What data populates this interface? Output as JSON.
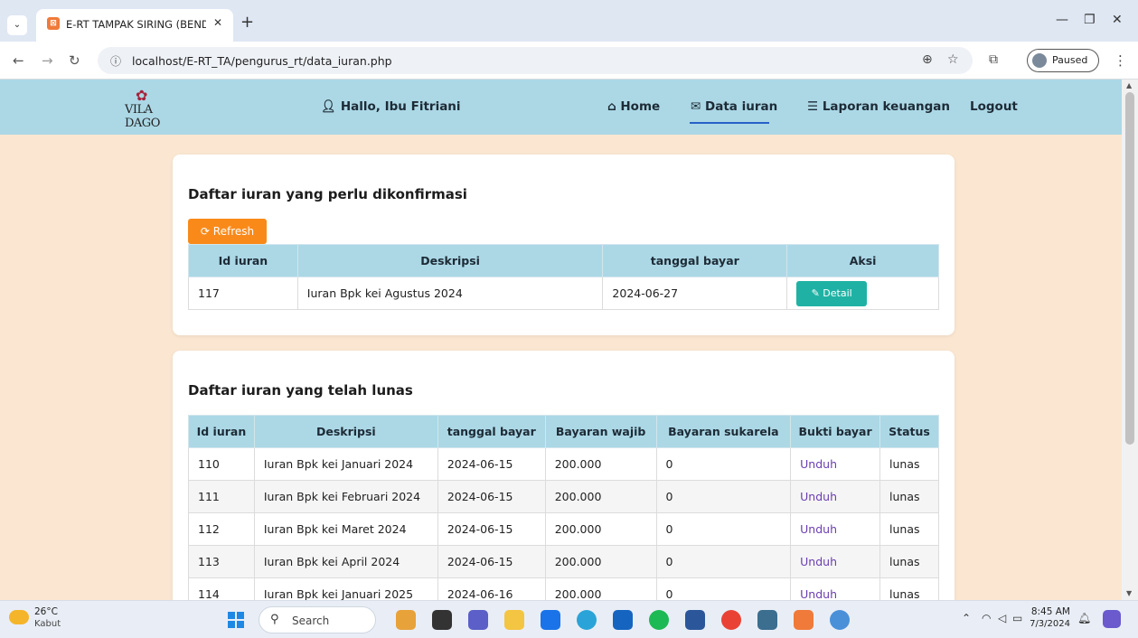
{
  "browser": {
    "tab_title": "E-RT TAMPAK SIRING (BENDAH",
    "url": "localhost/E-RT_TA/pengurus_rt/data_iuran.php",
    "profile_status": "Paused"
  },
  "navbar": {
    "logo_text": "VILA DAGO",
    "greeting": "Hallo, Ibu Fitriani",
    "items": [
      {
        "label": "Home",
        "icon": "home-icon"
      },
      {
        "label": "Data iuran",
        "icon": "envelope-icon"
      },
      {
        "label": "Laporan keuangan",
        "icon": "list-icon"
      },
      {
        "label": "Logout",
        "icon": ""
      }
    ]
  },
  "pending": {
    "title": "Daftar iuran yang perlu dikonfirmasi",
    "refresh_label": "Refresh",
    "columns": [
      "Id iuran",
      "Deskripsi",
      "tanggal bayar",
      "Aksi"
    ],
    "rows": [
      {
        "id": "117",
        "deskripsi": "Iuran Bpk kei Agustus 2024",
        "tanggal": "2024-06-27",
        "aksi": "Detail"
      }
    ]
  },
  "paid": {
    "title": "Daftar iuran yang telah lunas",
    "columns": [
      "Id iuran",
      "Deskripsi",
      "tanggal bayar",
      "Bayaran wajib",
      "Bayaran sukarela",
      "Bukti bayar",
      "Status"
    ],
    "rows": [
      {
        "id": "110",
        "deskripsi": "Iuran Bpk kei Januari 2024",
        "tanggal": "2024-06-15",
        "wajib": "200.000",
        "sukarela": "0",
        "bukti": "Unduh",
        "status": "lunas"
      },
      {
        "id": "111",
        "deskripsi": "Iuran Bpk kei Februari 2024",
        "tanggal": "2024-06-15",
        "wajib": "200.000",
        "sukarela": "0",
        "bukti": "Unduh",
        "status": "lunas"
      },
      {
        "id": "112",
        "deskripsi": "Iuran Bpk kei Maret 2024",
        "tanggal": "2024-06-15",
        "wajib": "200.000",
        "sukarela": "0",
        "bukti": "Unduh",
        "status": "lunas"
      },
      {
        "id": "113",
        "deskripsi": "Iuran Bpk kei April 2024",
        "tanggal": "2024-06-15",
        "wajib": "200.000",
        "sukarela": "0",
        "bukti": "Unduh",
        "status": "lunas"
      },
      {
        "id": "114",
        "deskripsi": "Iuran Bpk kei Januari 2025",
        "tanggal": "2024-06-16",
        "wajib": "200.000",
        "sukarela": "0",
        "bukti": "Unduh",
        "status": "lunas"
      }
    ]
  },
  "taskbar": {
    "weather_temp": "26°C",
    "weather_desc": "Kabut",
    "search_label": "Search",
    "time": "8:45 AM",
    "date": "7/3/2024"
  }
}
